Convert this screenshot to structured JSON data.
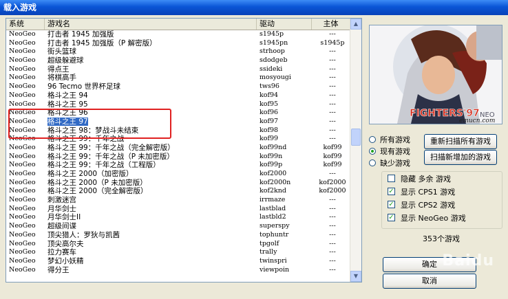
{
  "window": {
    "title": "载入游戏"
  },
  "columns": [
    "系统",
    "游戏名",
    "驱动",
    "主体"
  ],
  "rows": [
    [
      "NeoGeo",
      "打击者 1945 加强版",
      "s1945p",
      "---"
    ],
    [
      "NeoGeo",
      "打击者 1945 加强版（P 解密版）",
      "s1945pn",
      "s1945p"
    ],
    [
      "NeoGeo",
      "街头篮球",
      "strhoop",
      "---"
    ],
    [
      "NeoGeo",
      "超级躲避球",
      "sdodgeb",
      "---"
    ],
    [
      "NeoGeo",
      "得点王",
      "ssideki",
      "---"
    ],
    [
      "NeoGeo",
      "将棋高手",
      "mosyougi",
      "---"
    ],
    [
      "NeoGeo",
      "96 Tecmo 世界杯足球",
      "tws96",
      "---"
    ],
    [
      "NeoGeo",
      "格斗之王 94",
      "kof94",
      "---"
    ],
    [
      "NeoGeo",
      "格斗之王 95",
      "kof95",
      "---"
    ],
    [
      "NeoGeo",
      "格斗之王 96",
      "kof96",
      "---"
    ],
    [
      "NeoGeo",
      "格斗之王 97",
      "kof97",
      "---"
    ],
    [
      "NeoGeo",
      "格斗之王 98：梦战斗未结束",
      "kof98",
      "---"
    ],
    [
      "NeoGeo",
      "格斗之王 99：千年之战",
      "kof99",
      "---"
    ],
    [
      "NeoGeo",
      "格斗之王 99：千年之战（完全解密版）",
      "kof99nd",
      "kof99"
    ],
    [
      "NeoGeo",
      "格斗之王 99：千年之战（P 未加密版）",
      "kof99n",
      "kof99"
    ],
    [
      "NeoGeo",
      "格斗之王 99：千年之战（工程版）",
      "kof99p",
      "kof99"
    ],
    [
      "NeoGeo",
      "格斗之王 2000（加密版）",
      "kof2000",
      "---"
    ],
    [
      "NeoGeo",
      "格斗之王 2000（P 未加密版）",
      "kof2000n",
      "kof2000"
    ],
    [
      "NeoGeo",
      "格斗之王 2000（完全解密版）",
      "kof2knd",
      "kof2000"
    ],
    [
      "NeoGeo",
      "刺激迷宫",
      "irrmaze",
      "---"
    ],
    [
      "NeoGeo",
      "月华剑士",
      "lastblad",
      "---"
    ],
    [
      "NeoGeo",
      "月华剑士II",
      "lastbld2",
      "---"
    ],
    [
      "NeoGeo",
      "超级间谍",
      "superspy",
      "---"
    ],
    [
      "NeoGeo",
      "顶尖猎人：罗狄与凯茜",
      "tophuntr",
      "---"
    ],
    [
      "NeoGeo",
      "顶尖高尔夫",
      "tpgolf",
      "---"
    ],
    [
      "NeoGeo",
      "拉力赛车",
      "trally",
      "---"
    ],
    [
      "NeoGeo",
      "梦幻小妖精",
      "twinspri",
      "---"
    ],
    [
      "NeoGeo",
      "得分王",
      "viewpoin",
      "---"
    ]
  ],
  "selected_index": 10,
  "preview": {
    "logo_text": "FIGHTERS'97",
    "corner_text": "NEO",
    "site": "emucn.com"
  },
  "radios": [
    {
      "label": "所有游戏",
      "checked": false
    },
    {
      "label": "现有游戏",
      "checked": true
    },
    {
      "label": "缺少游戏",
      "checked": false
    }
  ],
  "buttons": {
    "rescan_all": "重新扫描所有游戏",
    "scan_new": "扫描新增加的游戏",
    "ok": "确定",
    "cancel": "取消"
  },
  "filters": [
    {
      "label": "隐藏 多余 游戏",
      "checked": false
    },
    {
      "label": "显示 CPS1 游戏",
      "checked": true
    },
    {
      "label": "显示 CPS2 游戏",
      "checked": true
    },
    {
      "label": "显示 NeoGeo 游戏",
      "checked": true
    }
  ],
  "count_text": "353个游戏",
  "watermark": "Baidu"
}
